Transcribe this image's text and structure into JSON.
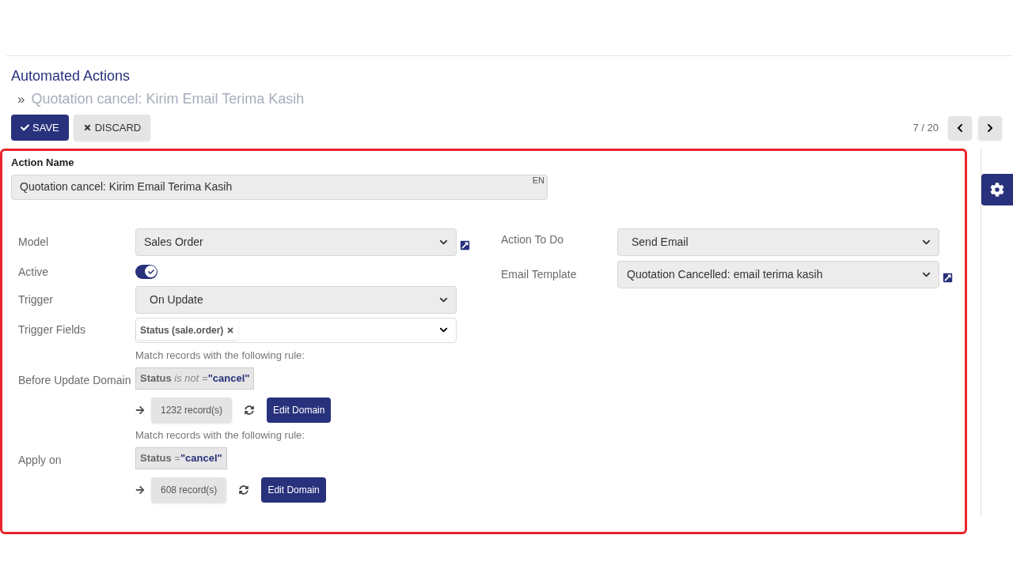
{
  "breadcrumb": {
    "parent": "Automated Actions",
    "separator": "»",
    "current": "Quotation cancel: Kirim Email Terima Kasih"
  },
  "buttons": {
    "save": "SAVE",
    "discard": "DISCARD"
  },
  "pager": {
    "text": "7 / 20"
  },
  "action_name": {
    "label": "Action Name",
    "value": "Quotation cancel: Kirim Email Terima Kasih",
    "lang": "EN"
  },
  "left_fields": {
    "model": {
      "label": "Model",
      "value": "Sales Order"
    },
    "active": {
      "label": "Active",
      "on": true
    },
    "trigger": {
      "label": "Trigger",
      "value": "On Update"
    },
    "trigger_fields": {
      "label": "Trigger Fields",
      "tags": [
        "Status (sale.order)"
      ]
    }
  },
  "domains": [
    {
      "label": "Before Update Domain",
      "hint": "Match records with the following rule:",
      "field": "Status",
      "operator": "is not =",
      "value": "\"cancel\"",
      "count": "1232 record(s)",
      "button": "Edit Domain"
    },
    {
      "label": "Apply on",
      "hint": "Match records with the following rule:",
      "field": "Status",
      "operator": "=",
      "value": "\"cancel\"",
      "count": "608 record(s)",
      "button": "Edit Domain"
    }
  ],
  "right_fields": {
    "action": {
      "label": "Action To Do",
      "value": "Send Email"
    },
    "template": {
      "label": "Email Template",
      "value": "Quotation Cancelled: email terima kasih"
    }
  }
}
